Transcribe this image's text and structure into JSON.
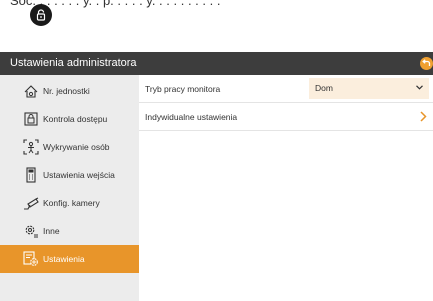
{
  "top_partial_text": "Soc. . . . . . . y. . p. . . . . y. . . . . . . . . .",
  "window": {
    "title": "Ustawienia administratora"
  },
  "sidebar": {
    "items": [
      {
        "label": "Nr. jednostki",
        "icon": "building-gear-icon"
      },
      {
        "label": "Kontrola dostępu",
        "icon": "lock-icon"
      },
      {
        "label": "Wykrywanie osób",
        "icon": "person-detect-icon"
      },
      {
        "label": "Ustawienia wejścia",
        "icon": "keypad-icon"
      },
      {
        "label": "Konfig. kamery",
        "icon": "camera-icon"
      },
      {
        "label": "Inne",
        "icon": "gear-icon"
      },
      {
        "label": "Ustawienia",
        "icon": "settings-icon"
      }
    ],
    "active_index": 6
  },
  "main": {
    "rows": [
      {
        "label": "Tryb pracy monitora",
        "value": "Dom"
      },
      {
        "label": "Indywidualne ustawienia"
      }
    ]
  },
  "colors": {
    "accent": "#e8952a",
    "titlebar": "#3d3d3d",
    "sidebar_bg": "#ececec",
    "select_bg": "#fbeedd"
  }
}
